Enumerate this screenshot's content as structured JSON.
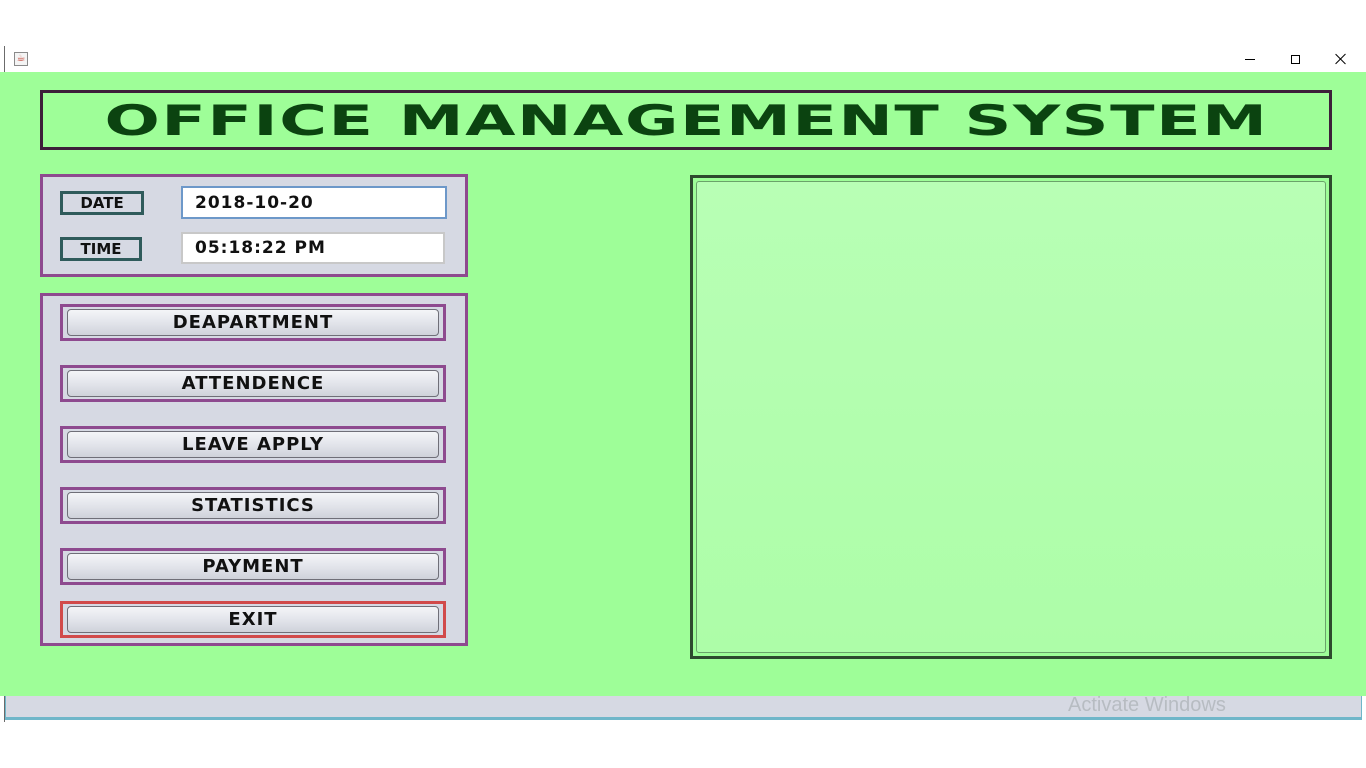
{
  "window": {
    "icon": "java-icon",
    "controls": {
      "minimize": "minimize-icon",
      "maximize": "maximize-icon",
      "close": "close-icon"
    }
  },
  "header": {
    "title": "OFFICE MANAGEMENT SYSTEM"
  },
  "datetime": {
    "date_label": "DATE",
    "date_value": "2018-10-20",
    "time_label": "TIME",
    "time_value": "05:18:22 PM"
  },
  "menu": {
    "items": [
      {
        "label": "DEAPARTMENT"
      },
      {
        "label": "ATTENDENCE"
      },
      {
        "label": "LEAVE APPLY"
      },
      {
        "label": "STATISTICS"
      },
      {
        "label": "PAYMENT"
      },
      {
        "label": "EXIT"
      }
    ]
  },
  "watermark": {
    "text": "Activate Windows"
  },
  "colors": {
    "background": "#9efe98",
    "panel": "#d6d9e3",
    "panel_border": "#8e4a8f",
    "header_text": "#0b4310",
    "exit_border": "#d14a4a"
  }
}
